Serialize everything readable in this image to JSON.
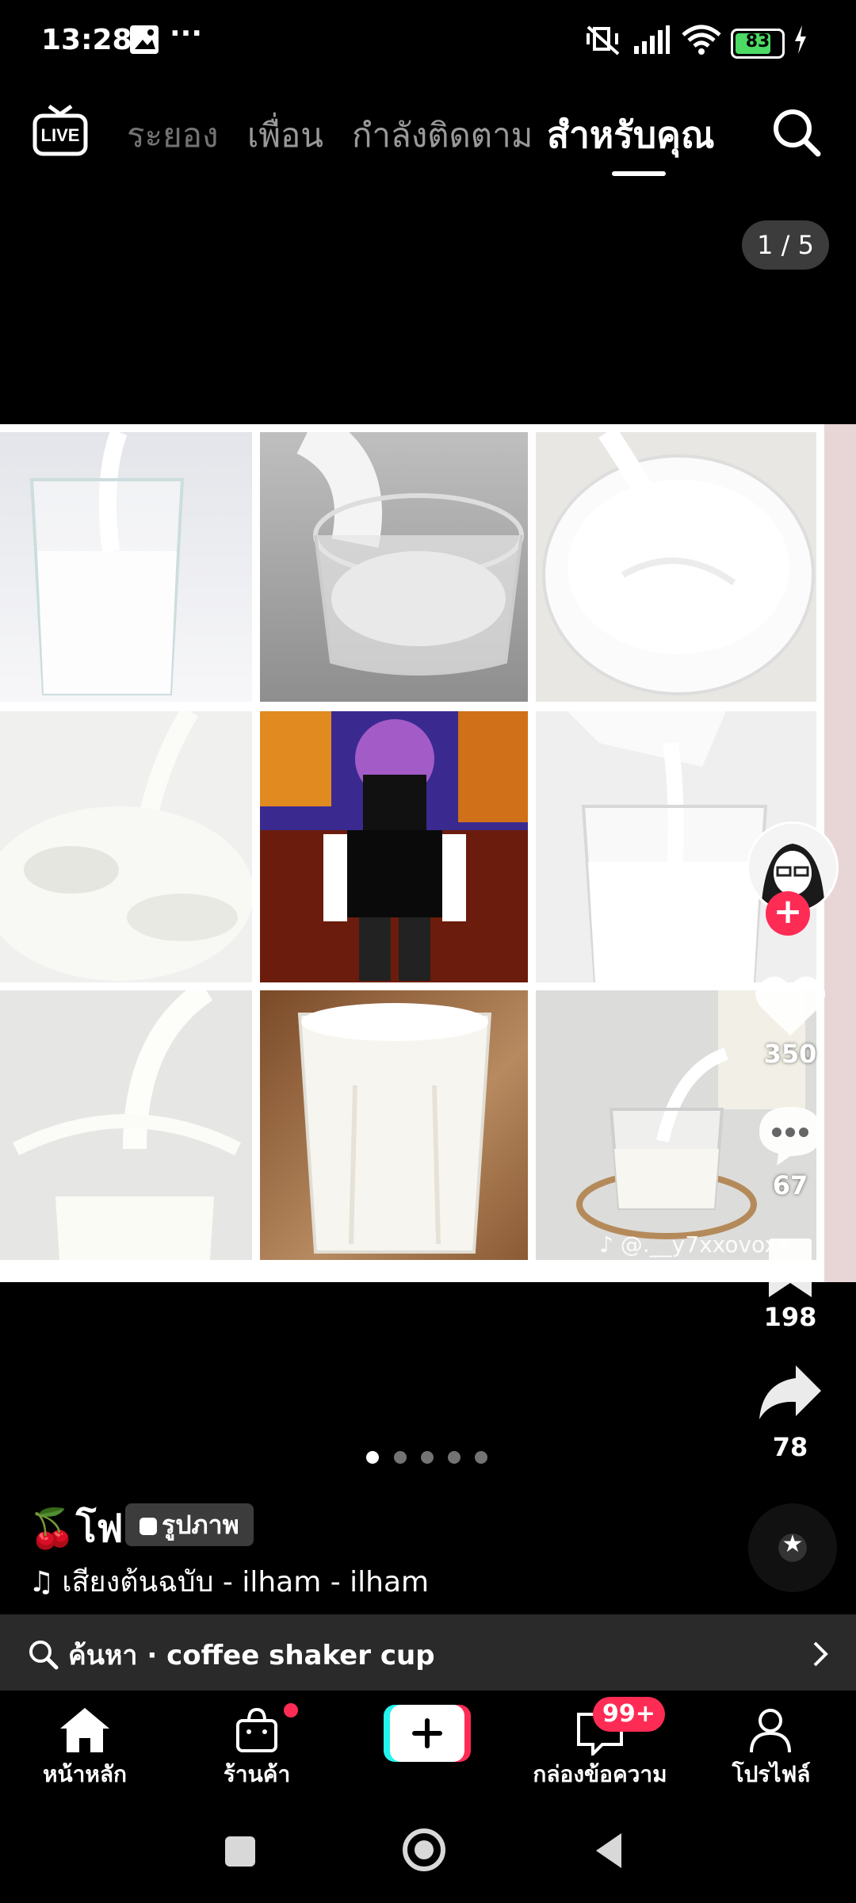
{
  "status_bar": {
    "time": "13:28",
    "dots": "···",
    "battery": "83"
  },
  "top_nav": {
    "tabs": [
      {
        "label": "ระยอง"
      },
      {
        "label": "เพื่อน"
      },
      {
        "label": "กำลังติดตาม"
      },
      {
        "label": "สำหรับคุณ",
        "active": true
      }
    ],
    "live_label": "LIVE"
  },
  "post": {
    "page_counter": "1 / 5",
    "watermark": "@.__y7xxovoxx",
    "slide_count": 5,
    "active_slide": 1,
    "author": "🍒โฟ",
    "badge": "รูปภาพ",
    "music": "เสียงต้นฉบับ - ilham - ilham"
  },
  "actions": {
    "likes": "350",
    "comments": "67",
    "saves": "198",
    "shares": "78"
  },
  "search_bar": {
    "text": "ค้นหา · coffee shaker cup"
  },
  "bottom_nav": {
    "items": [
      {
        "label": "หน้าหลัก",
        "active": true
      },
      {
        "label": "ร้านค้า"
      },
      {
        "label": ""
      },
      {
        "label": "กล่องข้อความ",
        "badge": "99+"
      },
      {
        "label": "โปรไฟล์"
      }
    ]
  },
  "colors": {
    "accent": "#fe2c55",
    "cyan": "#25f4ee",
    "background": "#000000"
  }
}
